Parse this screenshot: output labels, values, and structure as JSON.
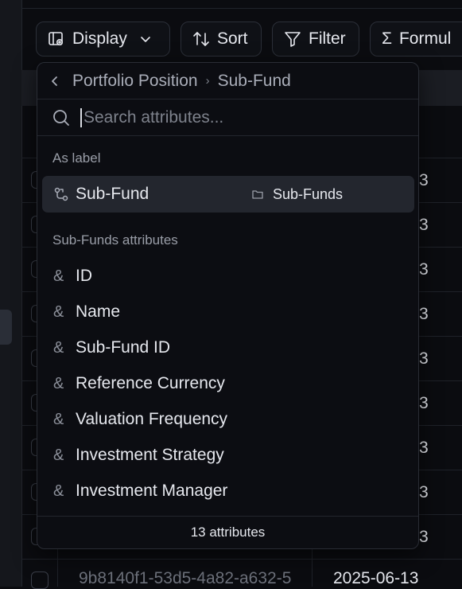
{
  "toolbar": {
    "display_label": "Display",
    "sort_label": "Sort",
    "filter_label": "Filter",
    "formula_label": "Formul"
  },
  "table": {
    "rows": [
      {
        "date": "3"
      },
      {
        "date": "3"
      },
      {
        "date": "3"
      },
      {
        "date": "3"
      },
      {
        "date": "3"
      },
      {
        "date": "3"
      },
      {
        "date": "3"
      },
      {
        "date": "3"
      },
      {
        "date": "3"
      }
    ],
    "last_row": {
      "id": "9b8140f1-53d5-4a82-a632-5",
      "date": "2025-06-13"
    }
  },
  "dropdown": {
    "breadcrumb": {
      "parent": "Portfolio Position",
      "current": "Sub-Fund"
    },
    "search": {
      "placeholder": "Search attributes...",
      "value": ""
    },
    "as_label": {
      "heading": "As label",
      "item": {
        "name": "Sub-Fund",
        "target": "Sub-Funds"
      }
    },
    "attributes": {
      "heading": "Sub-Funds attributes",
      "items": [
        "ID",
        "Name",
        "Sub-Fund ID",
        "Reference Currency",
        "Valuation Frequency",
        "Investment Strategy",
        "Investment Manager"
      ]
    },
    "footer": "13 attributes"
  }
}
